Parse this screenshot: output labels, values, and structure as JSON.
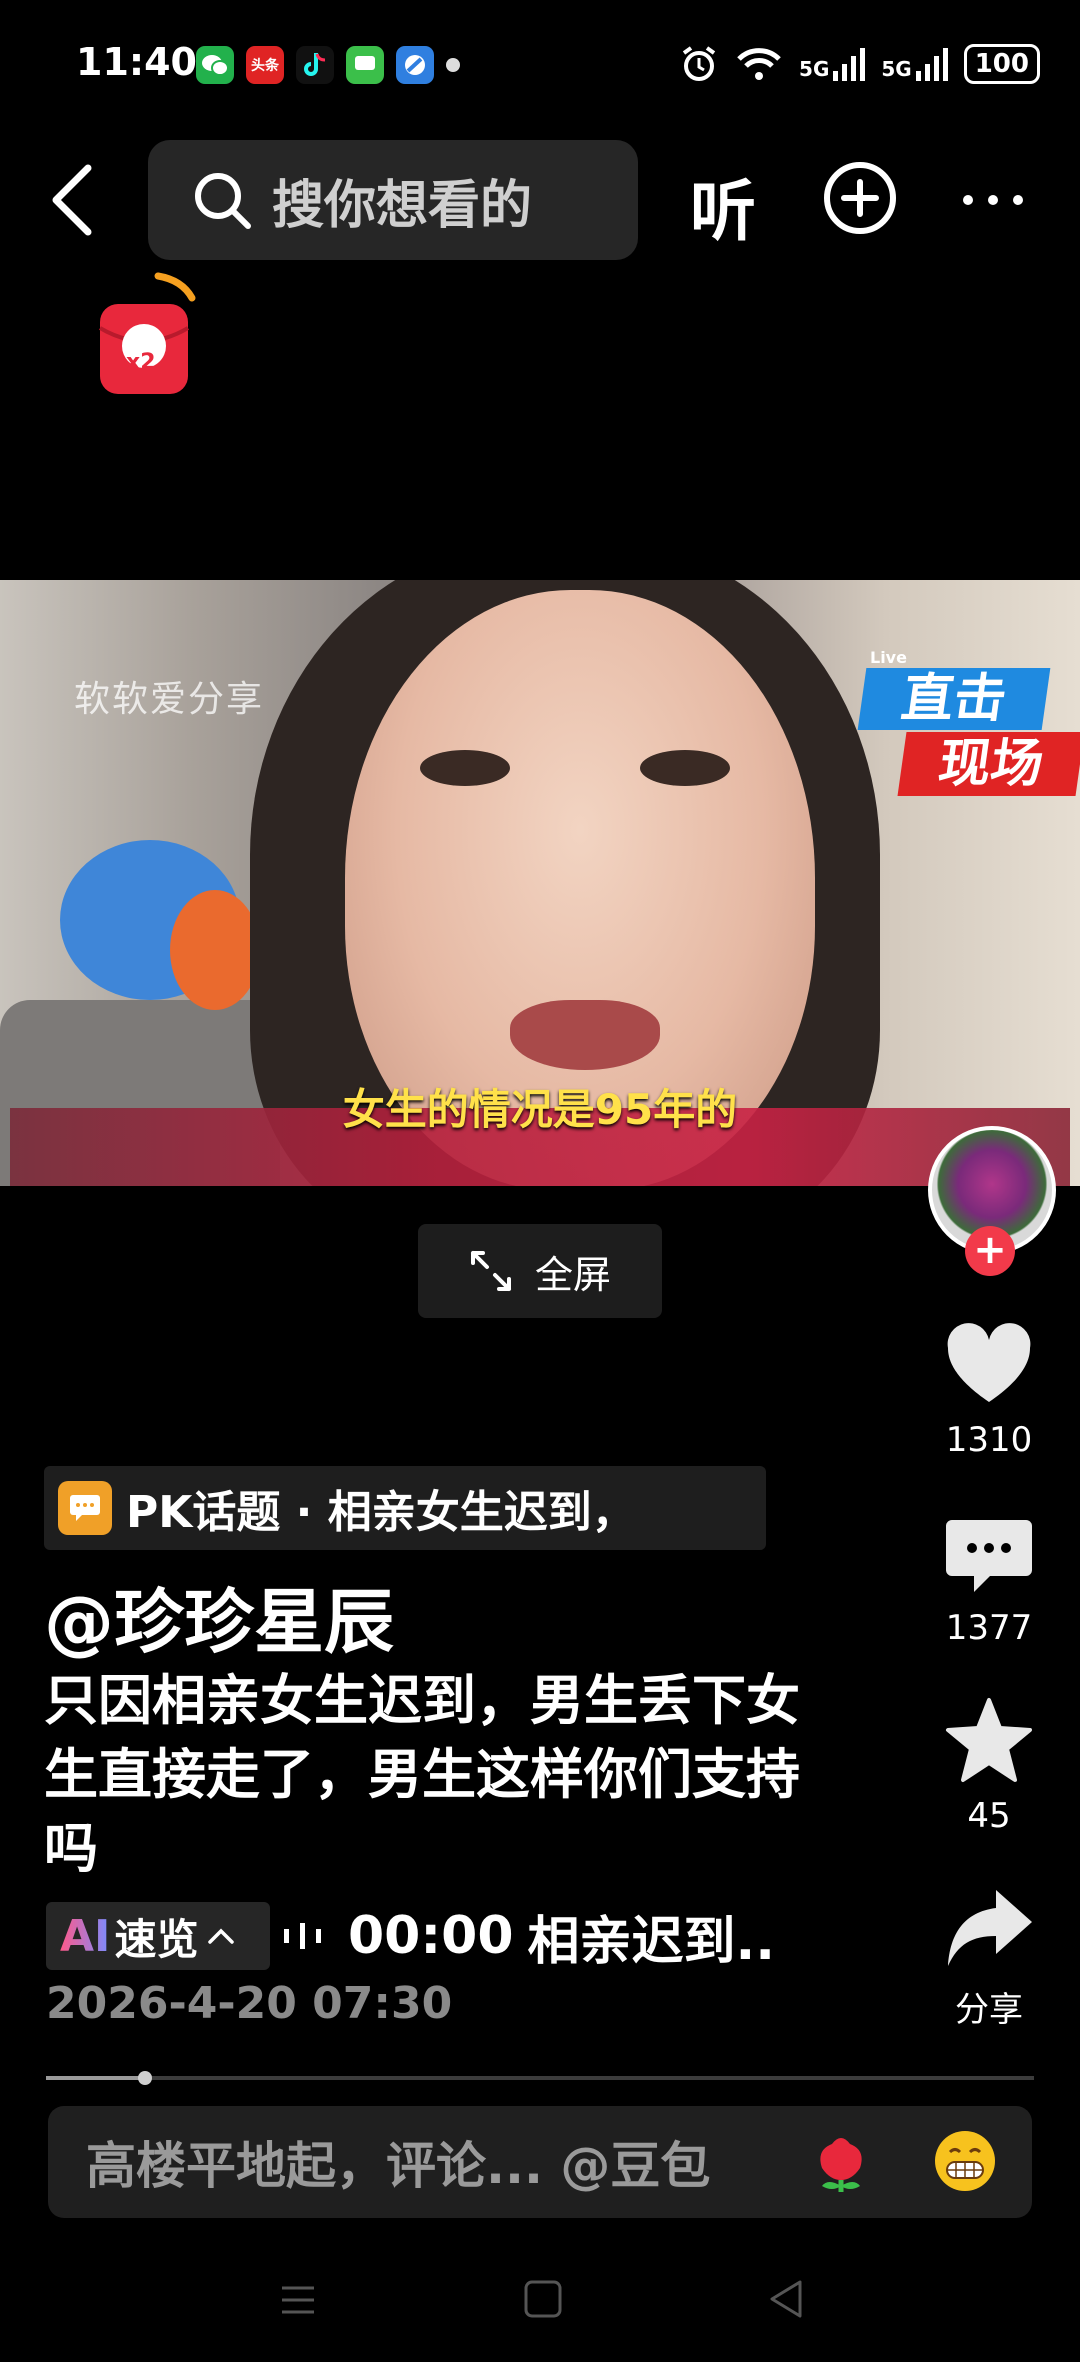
{
  "status_bar": {
    "time": "11:40",
    "apps": [
      {
        "icon": "wechat-icon",
        "color": "#22b14c"
      },
      {
        "icon": "toutiao-icon",
        "label": "头条",
        "color": "#e02424"
      },
      {
        "icon": "douyin-icon",
        "color": "#111111"
      },
      {
        "icon": "message-app-icon",
        "color": "#3bbf4a"
      },
      {
        "icon": "browser-icon",
        "color": "#2f7fe0"
      }
    ],
    "network": "5G",
    "network2": "5G",
    "battery": "100"
  },
  "top_nav": {
    "search_placeholder": "搜你想看的",
    "listen_label": "听"
  },
  "red_packet": {
    "multiplier": "x2"
  },
  "video": {
    "watermark": "软软爱分享",
    "live_tag": "Live",
    "badge_line1": "直击",
    "badge_line2": "现场",
    "caption": "女生的情况是95年的"
  },
  "fullscreen": {
    "label": "全屏"
  },
  "rail": {
    "likes": "1310",
    "comments": "1377",
    "favorites": "45",
    "share_label": "分享"
  },
  "post": {
    "pk_topic": "PK话题 · 相亲女生迟到，",
    "author": "@珍珍星辰",
    "description": "只因相亲女生迟到，男生丢下女生直接走了，男生这样你们支持吗",
    "ai_prefix": "AI",
    "ai_label": "速览",
    "audio_time": "00:00",
    "audio_title": "相亲迟到..",
    "date": "2026-4-20 07:30"
  },
  "progress": {
    "fraction": 0.1
  },
  "comment_bar": {
    "placeholder": "高楼平地起，评论... @豆包"
  },
  "colors": {
    "accent_red": "#f23a4a",
    "background": "#000000"
  }
}
